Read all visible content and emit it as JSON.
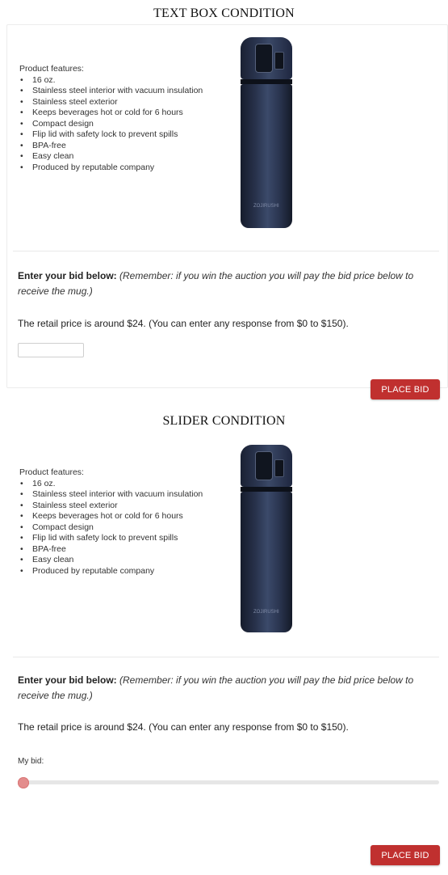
{
  "sections": [
    {
      "title": "TEXT BOX CONDITION",
      "features_title": "Product features:",
      "features": [
        "16 oz.",
        "Stainless steel interior with vacuum insulation",
        "Stainless steel exterior",
        "Keeps beverages hot or cold for 6 hours",
        "Compact design",
        "Flip lid with safety lock to prevent spills",
        "BPA-free",
        "Easy clean",
        "Produced by reputable company"
      ],
      "mug_brand": "ZOJIRUSHI",
      "bid_heading_bold": "Enter your bid below:",
      "bid_heading_italic": "(Remember: if you win the auction you will pay the bid price below to receive the mug.)",
      "retail_text": "The retail price is around $24. (You can enter any response from $0 to $150).",
      "input_value": "",
      "button_label": "PLACE BID"
    },
    {
      "title": "SLIDER CONDITION",
      "features_title": "Product features:",
      "features": [
        "16 oz.",
        "Stainless steel interior with vacuum insulation",
        "Stainless steel exterior",
        "Keeps beverages hot or cold for 6 hours",
        "Compact design",
        "Flip lid with safety lock to prevent spills",
        "BPA-free",
        "Easy clean",
        "Produced by reputable company"
      ],
      "mug_brand": "ZOJIRUSHI",
      "bid_heading_bold": "Enter your bid below:",
      "bid_heading_italic": "(Remember: if you win the auction you will pay the bid price below to receive the mug.)",
      "retail_text": "The retail price is around $24. (You can enter any response from $0 to $150).",
      "slider_label": "My bid:",
      "slider_min": 0,
      "slider_max": 150,
      "slider_value": 0,
      "button_label": "PLACE BID"
    }
  ],
  "colors": {
    "button": "#c0302f",
    "slider_thumb": "#e38c8c",
    "slider_track": "#e6e6e6"
  }
}
